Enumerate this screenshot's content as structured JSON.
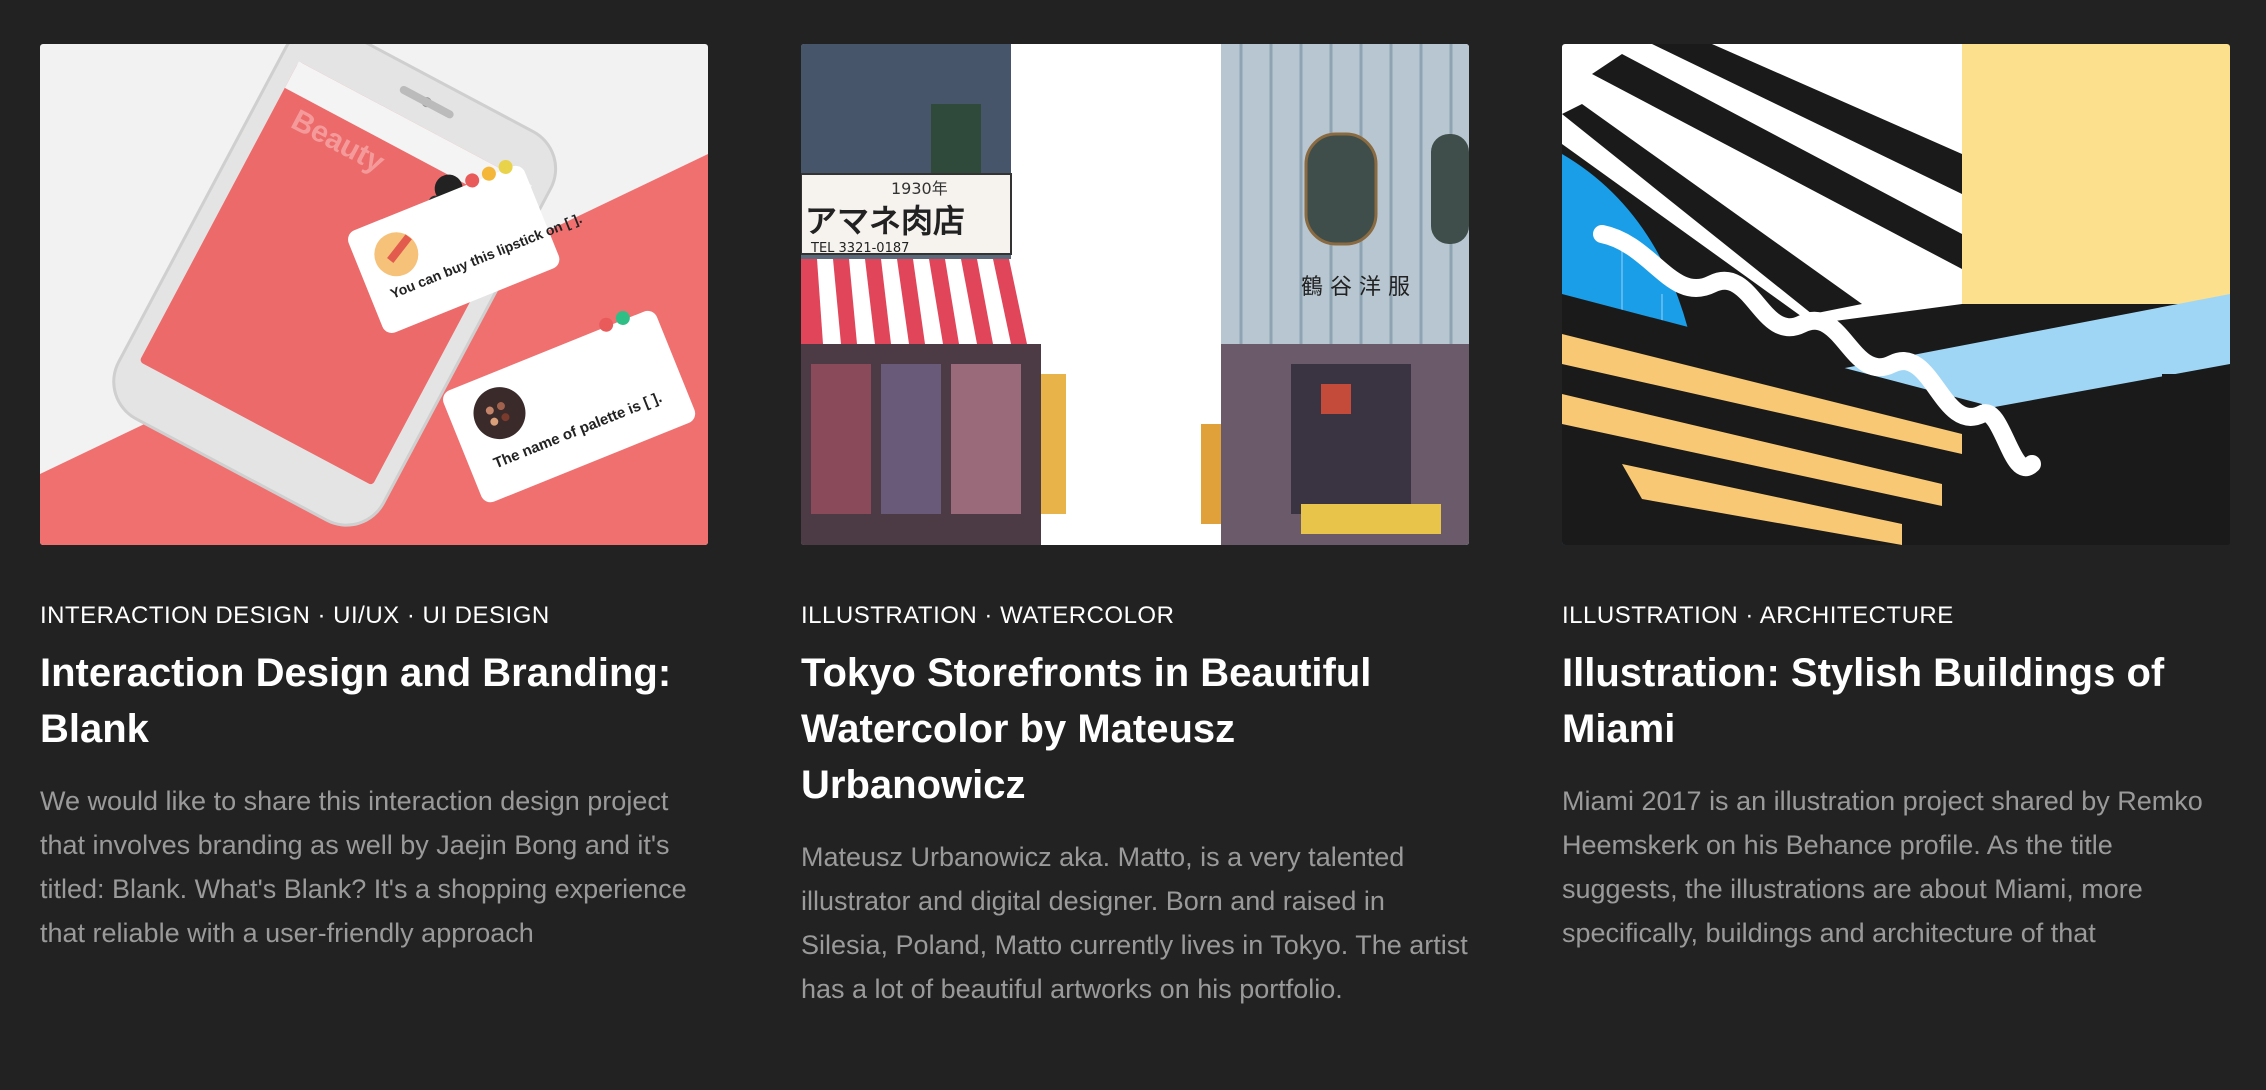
{
  "cards": [
    {
      "tags": "INTERACTION DESIGN · UI/UX · UI DESIGN",
      "title": "Interaction Design and Branding: Blank",
      "excerpt": "We would like to share this interaction design project that involves branding as well by Jaejin Bong and it's titled: Blank. What's Blank? It's a shopping experience that reliable with a user-friendly approach",
      "thumb": {
        "app_word": "Beauty",
        "card1_text": "You can buy this lipstick on [ ].",
        "card2_text": "The name of palette is [ ].",
        "bg_light": "#f2f2f2",
        "bg_coral": "#f07070"
      }
    },
    {
      "tags": "ILLUSTRATION · WATERCOLOR",
      "title": "Tokyo Storefronts in Beautiful Watercolor by Mateusz Urbanowicz",
      "excerpt": "Mateusz Urbanowicz aka. Matto, is a very talented illustrator and digital designer. Born and raised in Silesia, Poland, Matto currently lives in Tokyo. The artist has a lot of beautiful artworks on his portfolio.",
      "thumb": {
        "year_sign": "1930年",
        "shop_sign": "アマネ肉店",
        "phone_sign": "TEL 3321-0187",
        "right_sign": "鶴 谷 洋 服"
      }
    },
    {
      "tags": "ILLUSTRATION · ARCHITECTURE",
      "title": "Illustration: Stylish Buildings of Miami",
      "excerpt": "Miami 2017 is an illustration project  shared by Remko Heemskerk on his Behance profile. As the title suggests, the illustrations are about Miami, more specifically, buildings and architecture of that",
      "thumb": {
        "yellow": "#fde08e",
        "blue": "#1b9ee8",
        "lightblue": "#9fd6f5",
        "dark": "#1a1a1a"
      }
    }
  ]
}
